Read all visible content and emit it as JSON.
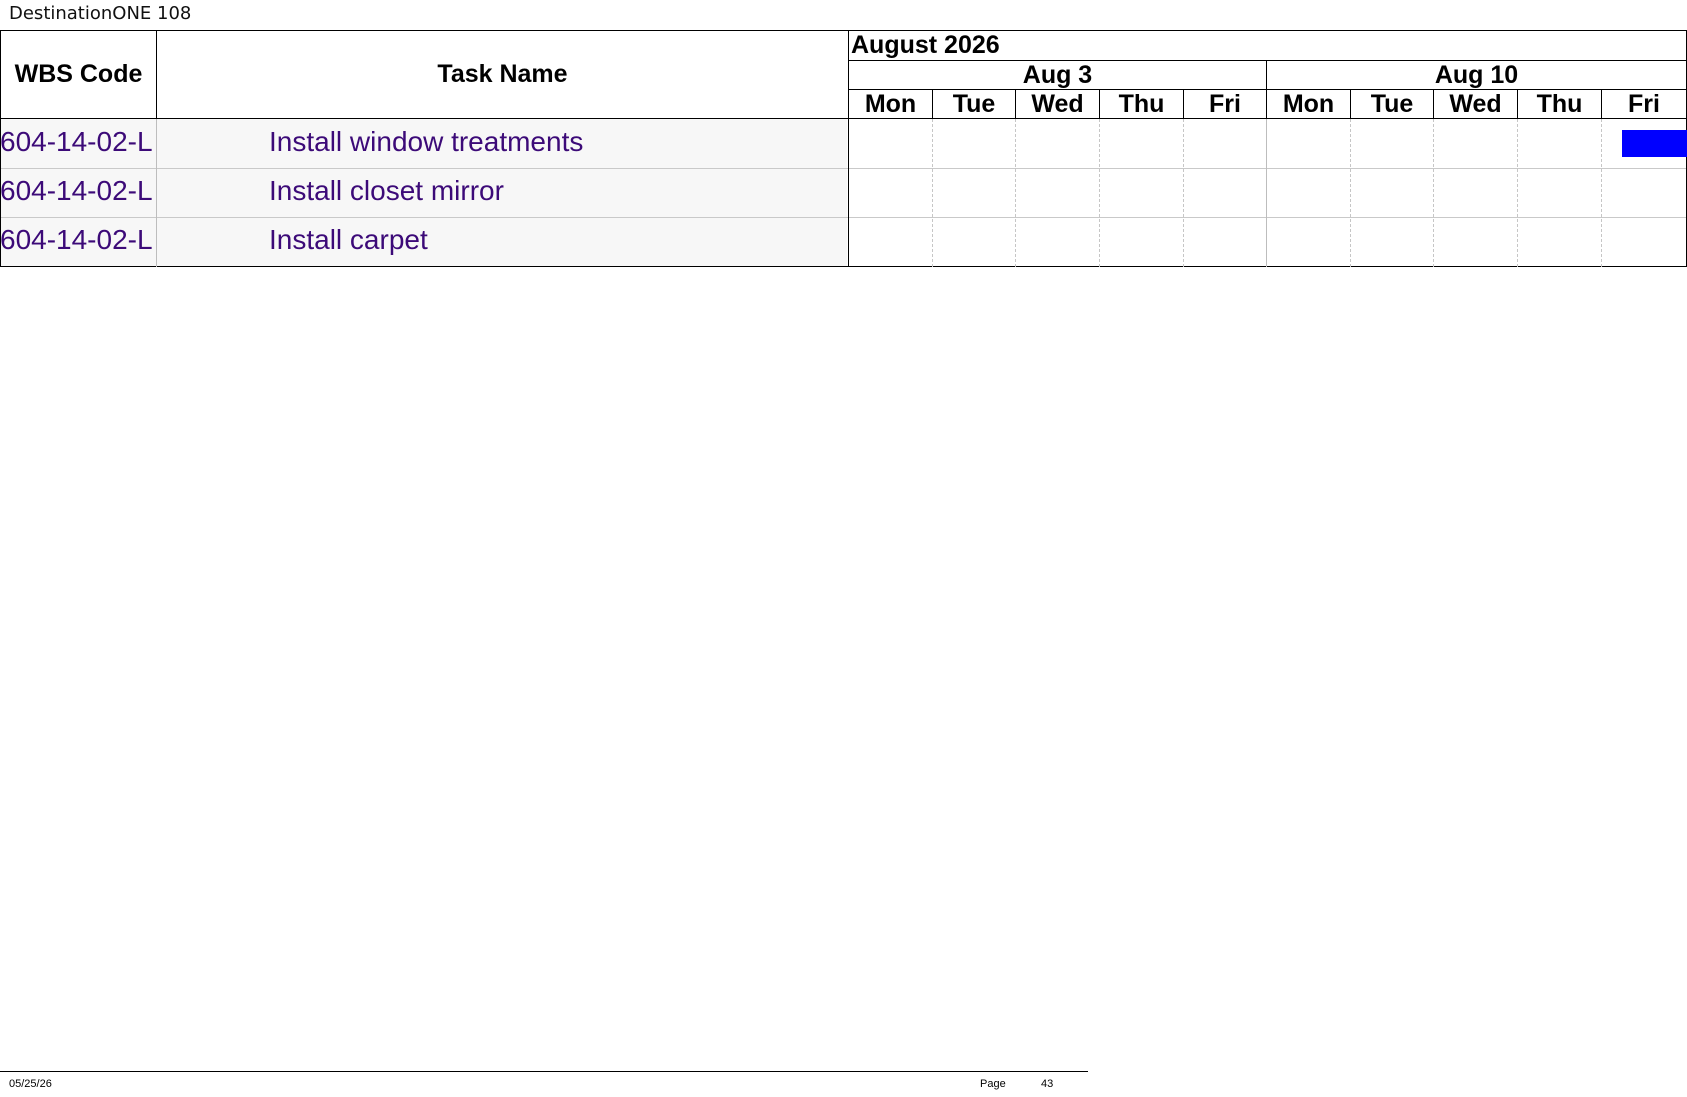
{
  "document": {
    "title": "DestinationONE 108"
  },
  "table": {
    "headers": {
      "wbs": "WBS Code",
      "task": "Task Name"
    },
    "timeline": {
      "month": "August 2026",
      "weeks": [
        "Aug 3",
        "Aug 10"
      ],
      "days": [
        "Mon",
        "Tue",
        "Wed",
        "Thu",
        "Fri",
        "Mon",
        "Tue",
        "Wed",
        "Thu",
        "Fri"
      ]
    },
    "rows": [
      {
        "wbs": "604-14-02-L",
        "task": "Install window treatments"
      },
      {
        "wbs": "604-14-02-L",
        "task": "Install closet mirror"
      },
      {
        "wbs": "604-14-02-L",
        "task": "Install carpet"
      }
    ],
    "bar_color": "#0000ff",
    "text_color": "#3c0a78"
  },
  "footer": {
    "date": "05/25/26",
    "page_label": "Page",
    "page_number": "43"
  }
}
